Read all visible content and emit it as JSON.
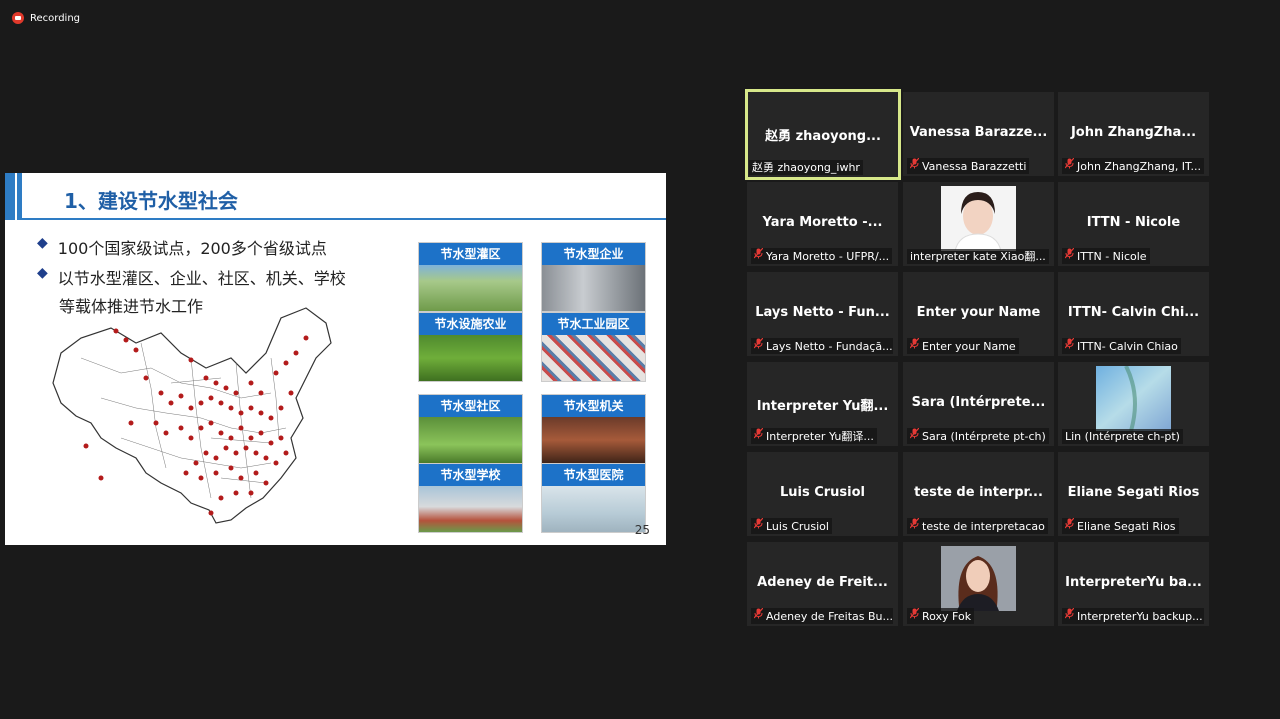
{
  "recording": {
    "label": "Recording"
  },
  "slide": {
    "title": "1、建设节水型社会",
    "bullets": [
      "100个国家级试点，200多个省级试点",
      "以节水型灌区、企业、社区、机关、学校"
    ],
    "bullet_cont": "等载体推进节水工作",
    "tiles": [
      "节水型灌区",
      "节水型企业",
      "节水设施农业",
      "节水工业园区",
      "节水型社区",
      "节水型机关",
      "节水型学校",
      "节水型医院"
    ],
    "page_number": "25"
  },
  "participants": [
    {
      "name": "赵勇 zhaoyong...",
      "label": "赵勇 zhaoyong_iwhr",
      "muted": false
    },
    {
      "name": "Vanessa Barazze...",
      "label": "Vanessa Barazzetti",
      "muted": true
    },
    {
      "name": "John ZhangZha...",
      "label": "John ZhangZhang, IT...",
      "muted": true
    },
    {
      "name": "Yara Moretto -...",
      "label": "Yara Moretto - UFPR/...",
      "muted": true
    },
    {
      "name": "",
      "label": "interpreter kate Xiao翻...",
      "muted": false
    },
    {
      "name": "ITTN - Nicole",
      "label": "ITTN - Nicole",
      "muted": true
    },
    {
      "name": "Lays Netto - Fun...",
      "label": "Lays Netto - Fundaçã...",
      "muted": true
    },
    {
      "name": "Enter your Name",
      "label": "Enter your Name",
      "muted": true
    },
    {
      "name": "ITTN- Calvin Chi...",
      "label": "ITTN- Calvin Chiao",
      "muted": true
    },
    {
      "name": "Interpreter Yu翻...",
      "label": "Interpreter Yu翻译...",
      "muted": true
    },
    {
      "name": "Sara (Intérprete...",
      "label": "Sara (Intérprete pt-ch)",
      "muted": true
    },
    {
      "name": "",
      "label": "Lin (Intérprete ch-pt)",
      "muted": false
    },
    {
      "name": "Luis Crusiol",
      "label": "Luis Crusiol",
      "muted": true
    },
    {
      "name": "teste de interpr...",
      "label": "teste de interpretacao",
      "muted": true
    },
    {
      "name": "Eliane Segati Rios",
      "label": "Eliane Segati Rios",
      "muted": true
    },
    {
      "name": "Adeney de Freit...",
      "label": "Adeney de Freitas Bu...",
      "muted": true
    },
    {
      "name": "",
      "label": "Roxy Fok",
      "muted": true
    },
    {
      "name": "InterpreterYu ba...",
      "label": "InterpreterYu backup...",
      "muted": true
    }
  ]
}
